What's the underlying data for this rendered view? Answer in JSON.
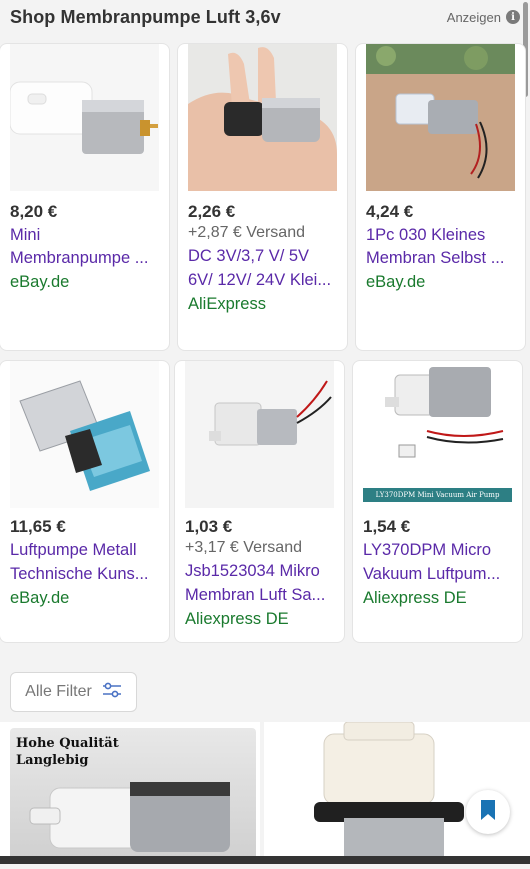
{
  "header": {
    "title": "Shop Membranpumpe Luft 3,6v",
    "ads_label": "Anzeigen"
  },
  "products": [
    {
      "price": "8,20 €",
      "title_line1": "Mini",
      "title_line2": "Membranpumpe ...",
      "merchant": "eBay.de"
    },
    {
      "price": "2,26 €",
      "shipping": "+2,87 € Versand",
      "title_line1": "DC 3V/3,7 V/ 5V",
      "title_line2": "6V/ 12V/ 24V Klei...",
      "merchant": "AliExpress"
    },
    {
      "price": "4,24 €",
      "title_line1": "1Pc 030 Kleines",
      "title_line2": "Membran Selbst ...",
      "merchant": "eBay.de"
    },
    {
      "price": "11,65 €",
      "title_line1": "Luftpumpe Metall",
      "title_line2": "Technische Kuns...",
      "merchant": "eBay.de"
    },
    {
      "price": "1,03 €",
      "shipping": "+3,17 € Versand",
      "title_line1": "Jsb1523034 Mikro",
      "title_line2": "Membran Luft Sa...",
      "merchant": "Aliexpress DE"
    },
    {
      "price": "1,54 €",
      "title_line1": "LY370DPM Micro",
      "title_line2": "Vakuum Luftpum...",
      "merchant": "Aliexpress DE"
    }
  ],
  "product6_banner": "LY370DPM Mini Vacuum Air Pump",
  "filter": {
    "label": "Alle Filter"
  },
  "promo": {
    "line1": "Hohe Qualität",
    "line2": "Langlebig"
  },
  "colors": {
    "title": "#5a29a8",
    "merchant": "#1a7a2e",
    "bookmark": "#1a73b4"
  },
  "icons": {
    "info": "info-icon",
    "filter": "sliders-icon",
    "bookmark": "bookmark-icon"
  }
}
